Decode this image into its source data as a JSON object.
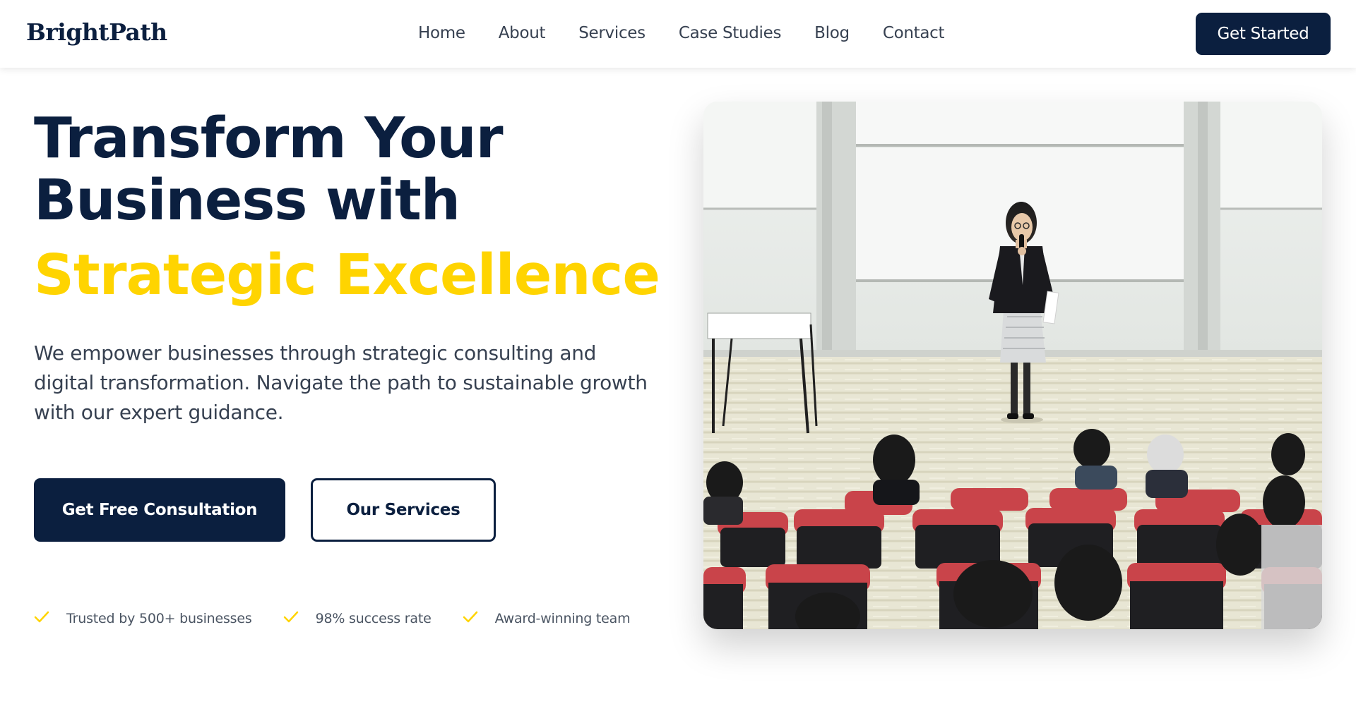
{
  "nav": {
    "logo": "BrightPath",
    "links": [
      "Home",
      "About",
      "Services",
      "Case Studies",
      "Blog",
      "Contact"
    ],
    "cta": "Get Started"
  },
  "hero": {
    "headline_line1": "Transform Your",
    "headline_line2": "Business with",
    "headline_accent": "Strategic Excellence",
    "description": "We empower businesses through strategic consulting and digital transformation. Navigate the path to sustainable growth with our expert guidance.",
    "primary_button": "Get Free Consultation",
    "secondary_button": "Our Services",
    "trust_items": [
      "Trusted by 500+ businesses",
      "98% success rate",
      "Award-winning team"
    ]
  },
  "colors": {
    "navy": "#0b1f3f",
    "accent_yellow": "#ffd400",
    "text_gray": "#374151"
  },
  "icons": {
    "trust_check": "check-icon"
  }
}
